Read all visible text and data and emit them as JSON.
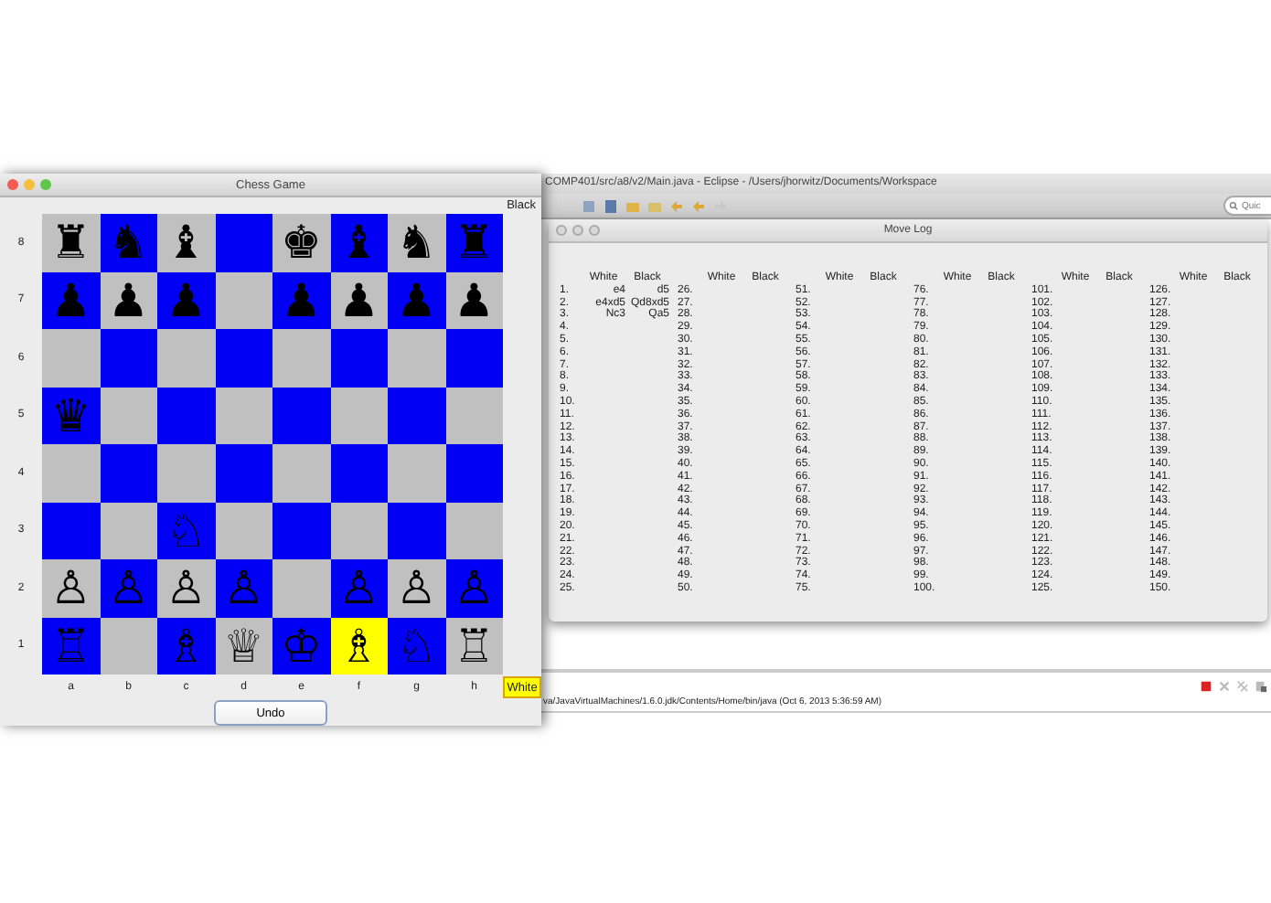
{
  "eclipse_window": {
    "title": "COMP401/src/a8/v2/Main.java - Eclipse - /Users/jhorwitz/Documents/Workspace",
    "search": {
      "placeholder": "Quic"
    },
    "console": {
      "path": "va/JavaVirtualMachines/1.6.0.jdk/Contents/Home/bin/java (Oct 6, 2013 5:36:59 AM)"
    }
  },
  "move_log": {
    "title": "Move Log",
    "groups": [
      {
        "headers": [
          "White",
          "Black"
        ],
        "rows": [
          {
            "number": "1.",
            "white": "e4",
            "black": "d5"
          },
          {
            "number": "2.",
            "white": "e4xd5",
            "black": "Qd8xd5"
          },
          {
            "number": "3.",
            "white": "Nc3",
            "black": "Qa5"
          },
          {
            "number": "4."
          },
          {
            "number": "5."
          },
          {
            "number": "6."
          },
          {
            "number": "7."
          },
          {
            "number": "8."
          },
          {
            "number": "9."
          },
          {
            "number": "10."
          },
          {
            "number": "11."
          },
          {
            "number": "12."
          },
          {
            "number": "13."
          },
          {
            "number": "14."
          },
          {
            "number": "15."
          },
          {
            "number": "16."
          },
          {
            "number": "17."
          },
          {
            "number": "18."
          },
          {
            "number": "19."
          },
          {
            "number": "20."
          },
          {
            "number": "21."
          },
          {
            "number": "22."
          },
          {
            "number": "23."
          },
          {
            "number": "24."
          },
          {
            "number": "25."
          }
        ]
      },
      {
        "headers": [
          "White",
          "Black"
        ],
        "rows": [
          {
            "number": "26."
          },
          {
            "number": "27."
          },
          {
            "number": "28."
          },
          {
            "number": "29."
          },
          {
            "number": "30."
          },
          {
            "number": "31."
          },
          {
            "number": "32."
          },
          {
            "number": "33."
          },
          {
            "number": "34."
          },
          {
            "number": "35."
          },
          {
            "number": "36."
          },
          {
            "number": "37."
          },
          {
            "number": "38."
          },
          {
            "number": "39."
          },
          {
            "number": "40."
          },
          {
            "number": "41."
          },
          {
            "number": "42."
          },
          {
            "number": "43."
          },
          {
            "number": "44."
          },
          {
            "number": "45."
          },
          {
            "number": "46."
          },
          {
            "number": "47."
          },
          {
            "number": "48."
          },
          {
            "number": "49."
          },
          {
            "number": "50."
          }
        ]
      },
      {
        "headers": [
          "White",
          "Black"
        ],
        "rows": [
          {
            "number": "51."
          },
          {
            "number": "52."
          },
          {
            "number": "53."
          },
          {
            "number": "54."
          },
          {
            "number": "55."
          },
          {
            "number": "56."
          },
          {
            "number": "57."
          },
          {
            "number": "58."
          },
          {
            "number": "59."
          },
          {
            "number": "60."
          },
          {
            "number": "61."
          },
          {
            "number": "62."
          },
          {
            "number": "63."
          },
          {
            "number": "64."
          },
          {
            "number": "65."
          },
          {
            "number": "66."
          },
          {
            "number": "67."
          },
          {
            "number": "68."
          },
          {
            "number": "69."
          },
          {
            "number": "70."
          },
          {
            "number": "71."
          },
          {
            "number": "72."
          },
          {
            "number": "73."
          },
          {
            "number": "74."
          },
          {
            "number": "75."
          }
        ]
      },
      {
        "headers": [
          "White",
          "Black"
        ],
        "rows": [
          {
            "number": "76."
          },
          {
            "number": "77."
          },
          {
            "number": "78."
          },
          {
            "number": "79."
          },
          {
            "number": "80."
          },
          {
            "number": "81."
          },
          {
            "number": "82."
          },
          {
            "number": "83."
          },
          {
            "number": "84."
          },
          {
            "number": "85."
          },
          {
            "number": "86."
          },
          {
            "number": "87."
          },
          {
            "number": "88."
          },
          {
            "number": "89."
          },
          {
            "number": "90."
          },
          {
            "number": "91."
          },
          {
            "number": "92."
          },
          {
            "number": "93."
          },
          {
            "number": "94."
          },
          {
            "number": "95."
          },
          {
            "number": "96."
          },
          {
            "number": "97."
          },
          {
            "number": "98."
          },
          {
            "number": "99."
          },
          {
            "number": "100."
          }
        ]
      },
      {
        "headers": [
          "White",
          "Black"
        ],
        "rows": [
          {
            "number": "101."
          },
          {
            "number": "102."
          },
          {
            "number": "103."
          },
          {
            "number": "104."
          },
          {
            "number": "105."
          },
          {
            "number": "106."
          },
          {
            "number": "107."
          },
          {
            "number": "108."
          },
          {
            "number": "109."
          },
          {
            "number": "110."
          },
          {
            "number": "111."
          },
          {
            "number": "112."
          },
          {
            "number": "113."
          },
          {
            "number": "114."
          },
          {
            "number": "115."
          },
          {
            "number": "116."
          },
          {
            "number": "117."
          },
          {
            "number": "118."
          },
          {
            "number": "119."
          },
          {
            "number": "120."
          },
          {
            "number": "121."
          },
          {
            "number": "122."
          },
          {
            "number": "123."
          },
          {
            "number": "124."
          },
          {
            "number": "125."
          }
        ]
      },
      {
        "headers": [
          "White",
          "Black"
        ],
        "rows": [
          {
            "number": "126."
          },
          {
            "number": "127."
          },
          {
            "number": "128."
          },
          {
            "number": "129."
          },
          {
            "number": "130."
          },
          {
            "number": "131."
          },
          {
            "number": "132."
          },
          {
            "number": "133."
          },
          {
            "number": "134."
          },
          {
            "number": "135."
          },
          {
            "number": "136."
          },
          {
            "number": "137."
          },
          {
            "number": "138."
          },
          {
            "number": "139."
          },
          {
            "number": "140."
          },
          {
            "number": "141."
          },
          {
            "number": "142."
          },
          {
            "number": "143."
          },
          {
            "number": "144."
          },
          {
            "number": "145."
          },
          {
            "number": "146."
          },
          {
            "number": "147."
          },
          {
            "number": "148."
          },
          {
            "number": "149."
          },
          {
            "number": "150."
          }
        ]
      }
    ]
  },
  "chess_window": {
    "title": "Chess Game",
    "top_player": "Black",
    "ranks": [
      {
        "label": "8",
        "squares": [
          {
            "piece": "♜",
            "selected": false
          },
          {
            "piece": "♞",
            "selected": false
          },
          {
            "piece": "♝",
            "selected": false
          },
          {
            "selected": false
          },
          {
            "piece": "♚",
            "selected": false
          },
          {
            "piece": "♝",
            "selected": false
          },
          {
            "piece": "♞",
            "selected": false
          },
          {
            "piece": "♜",
            "selected": false
          }
        ]
      },
      {
        "label": "7",
        "squares": [
          {
            "piece": "♟",
            "selected": false
          },
          {
            "piece": "♟",
            "selected": false
          },
          {
            "piece": "♟",
            "selected": false
          },
          {
            "selected": false
          },
          {
            "piece": "♟",
            "selected": false
          },
          {
            "piece": "♟",
            "selected": false
          },
          {
            "piece": "♟",
            "selected": false
          },
          {
            "piece": "♟",
            "selected": false
          }
        ]
      },
      {
        "label": "6",
        "squares": [
          {
            "selected": false
          },
          {
            "selected": false
          },
          {
            "selected": false
          },
          {
            "selected": false
          },
          {
            "selected": false
          },
          {
            "selected": false
          },
          {
            "selected": false
          },
          {
            "selected": false
          }
        ]
      },
      {
        "label": "5",
        "squares": [
          {
            "piece": "♛",
            "selected": false
          },
          {
            "selected": false
          },
          {
            "selected": false
          },
          {
            "selected": false
          },
          {
            "selected": false
          },
          {
            "selected": false
          },
          {
            "selected": false
          },
          {
            "selected": false
          }
        ]
      },
      {
        "label": "4",
        "squares": [
          {
            "selected": false
          },
          {
            "selected": false
          },
          {
            "selected": false
          },
          {
            "selected": false
          },
          {
            "selected": false
          },
          {
            "selected": false
          },
          {
            "selected": false
          },
          {
            "selected": false
          }
        ]
      },
      {
        "label": "3",
        "squares": [
          {
            "selected": false
          },
          {
            "selected": false
          },
          {
            "piece": "♘",
            "selected": false
          },
          {
            "selected": false
          },
          {
            "selected": false
          },
          {
            "selected": false
          },
          {
            "selected": false
          },
          {
            "selected": false
          }
        ]
      },
      {
        "label": "2",
        "squares": [
          {
            "piece": "♙",
            "selected": false
          },
          {
            "piece": "♙",
            "selected": false
          },
          {
            "piece": "♙",
            "selected": false
          },
          {
            "piece": "♙",
            "selected": false
          },
          {
            "selected": false
          },
          {
            "piece": "♙",
            "selected": false
          },
          {
            "piece": "♙",
            "selected": false
          },
          {
            "piece": "♙",
            "selected": false
          }
        ]
      },
      {
        "label": "1",
        "squares": [
          {
            "piece": "♖",
            "selected": false
          },
          {
            "selected": false
          },
          {
            "piece": "♗",
            "selected": false
          },
          {
            "piece": "♕",
            "selected": false
          },
          {
            "piece": "♔",
            "selected": false
          },
          {
            "piece": "♗",
            "selected": true
          },
          {
            "piece": "♘",
            "selected": false
          },
          {
            "piece": "♖",
            "selected": false
          }
        ]
      }
    ],
    "files": [
      "a",
      "b",
      "c",
      "d",
      "e",
      "f",
      "g",
      "h"
    ],
    "bottom_player": "White",
    "undo_button": "Undo"
  }
}
